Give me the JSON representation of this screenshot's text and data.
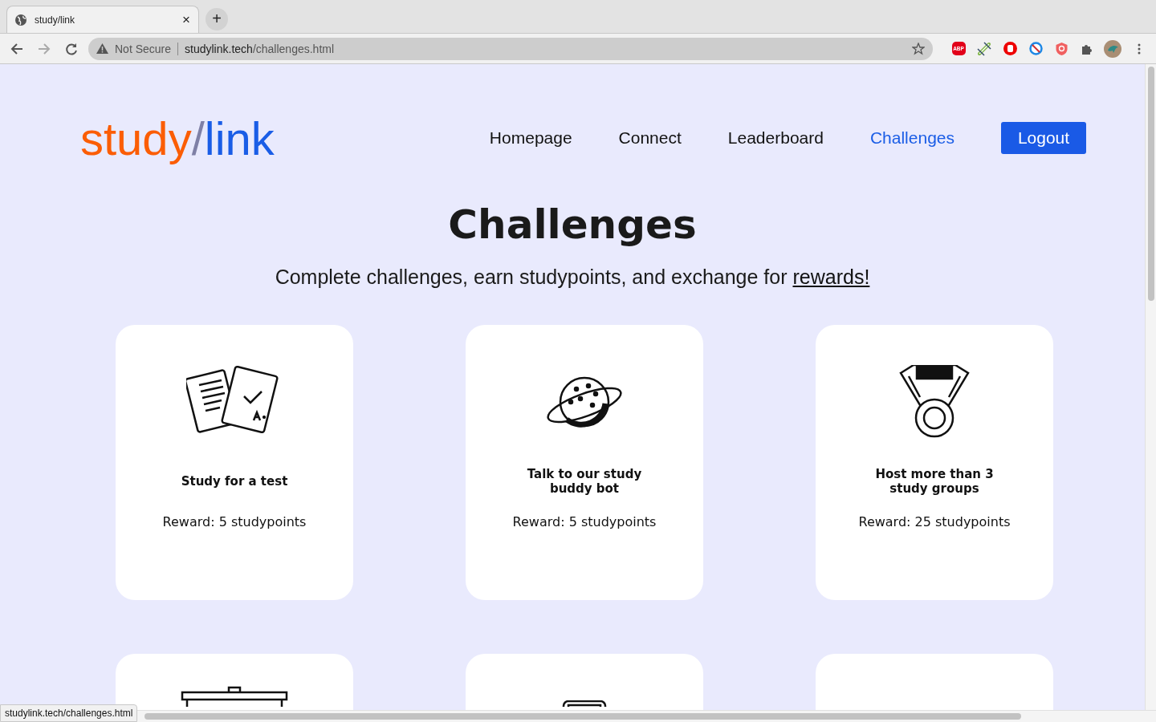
{
  "browser": {
    "tab": {
      "title": "study/link",
      "close": "×"
    },
    "new_tab": "+",
    "address": {
      "security": "Not Secure",
      "host": "studylink.tech",
      "path": "/challenges.html"
    },
    "extensions": [
      {
        "kind": "abp",
        "label": "ABP"
      },
      {
        "kind": "clip"
      },
      {
        "kind": "hand"
      },
      {
        "kind": "block"
      },
      {
        "kind": "shield"
      },
      {
        "kind": "puzzle"
      },
      {
        "kind": "avatar"
      }
    ]
  },
  "header": {
    "logo": [
      "study",
      "/",
      "link"
    ],
    "nav": [
      {
        "label": "Homepage",
        "selected": false
      },
      {
        "label": "Connect",
        "selected": false
      },
      {
        "label": "Leaderboard",
        "selected": false
      },
      {
        "label": "Challenges",
        "selected": true
      }
    ],
    "logout": "Logout"
  },
  "title": "Challenges",
  "subtitle": {
    "text": "Complete challenges, earn studypoints, and exchange for",
    "link": "rewards!"
  },
  "cards": [
    {
      "kind": "papers",
      "title": "Study for a test",
      "reward": "Reward:  5 studypoints"
    },
    {
      "kind": "planet",
      "title": "Talk to our study buddy bot",
      "reward": "Reward: 5 studypoints"
    },
    {
      "kind": "medal",
      "title": "Host more than 3 study groups",
      "reward": "Reward: 25 studypoints"
    },
    {
      "kind": "bin"
    },
    {
      "kind": "tray"
    },
    {
      "kind": "blank"
    }
  ],
  "status_bar": "studylink.tech/challenges.html"
}
